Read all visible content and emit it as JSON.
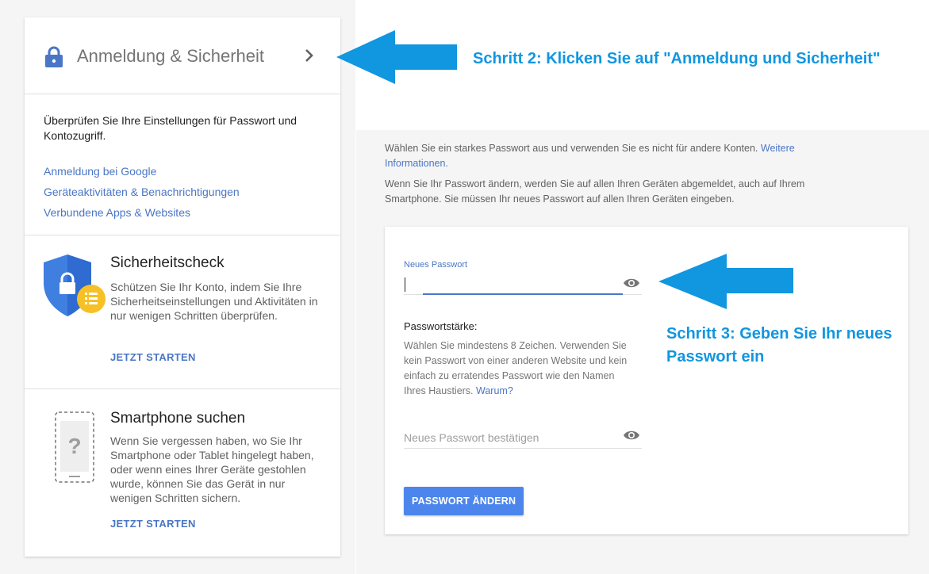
{
  "colors": {
    "accent": "#4a76c6",
    "annotation": "#1196e0",
    "button": "#4c86ec",
    "shield": "#3f7fe0",
    "badge": "#f6c026"
  },
  "left_card": {
    "header": {
      "title": "Anmeldung & Sicherheit",
      "icon": "lock-icon"
    },
    "section1": {
      "description": "Überprüfen Sie Ihre Einstellungen für Passwort und Kontozugriff.",
      "links": [
        "Anmeldung bei Google",
        "Geräteaktivitäten & Benachrichtigungen",
        "Verbundene Apps & Websites"
      ]
    },
    "security_check": {
      "title": "Sicherheitscheck",
      "body": "Schützen Sie Ihr Konto, indem Sie Ihre Sicherheitseinstellungen und Aktivitäten in nur wenigen Schritten überprüfen.",
      "cta": "JETZT STARTEN"
    },
    "find_phone": {
      "title": "Smartphone suchen",
      "body": "Wenn Sie vergessen haben, wo Sie Ihr Smartphone oder Tablet hingelegt haben, oder wenn eines Ihrer Geräte gestohlen wurde, können Sie das Gerät in nur wenigen Schritten sichern.",
      "cta": "JETZT STARTEN"
    }
  },
  "annotations": {
    "step2": "Schritt 2: Klicken Sie auf \"Anmeldung und Sicherheit\"",
    "step3_line1": "Schritt 3: Geben Sie Ihr neues",
    "step3_line2": "Passwort ein"
  },
  "right_panel": {
    "intro_text": "Wählen Sie ein starkes Passwort aus und verwenden Sie es nicht für andere Konten.",
    "intro_link": "Weitere Informationen.",
    "info_text": "Wenn Sie Ihr Passwort ändern, werden Sie auf allen Ihren Geräten abgemeldet, auch auf Ihrem Smartphone. Sie müssen Ihr neues Passwort auf allen Ihren Geräten eingeben.",
    "form": {
      "new_password_label": "Neues Passwort",
      "new_password_value": "",
      "strength_label": "Passwortstärke:",
      "help_text": "Wählen Sie mindestens 8 Zeichen. Verwenden Sie kein Passwort von einer anderen Website und kein einfach zu erratendes Passwort wie den Namen Ihres Haustiers.",
      "help_link": "Warum?",
      "confirm_placeholder": "Neues Passwort bestätigen",
      "submit_label": "PASSWORT ÄNDERN"
    }
  }
}
